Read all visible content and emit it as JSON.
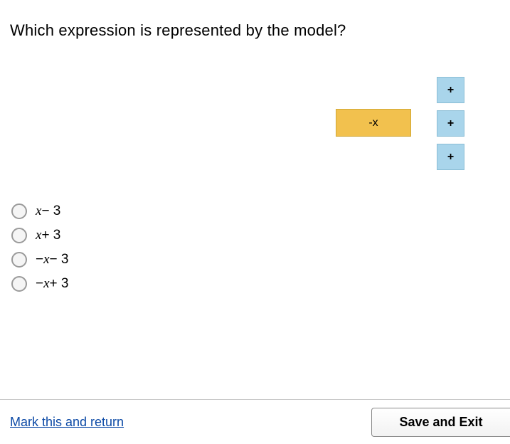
{
  "question": "Which expression is represented by the model?",
  "model": {
    "neg_x_tile": "-x",
    "plus_tile": "+",
    "plus_count": 3
  },
  "options": [
    {
      "var": "x",
      "suffix": "− 3"
    },
    {
      "var": "x",
      "suffix": "+ 3"
    },
    {
      "prefix": "−",
      "var": "x",
      "suffix": "− 3"
    },
    {
      "prefix": "−",
      "var": "x",
      "suffix": "+ 3"
    }
  ],
  "footer": {
    "mark_link": "Mark this and return",
    "save_button": "Save and Exit"
  }
}
